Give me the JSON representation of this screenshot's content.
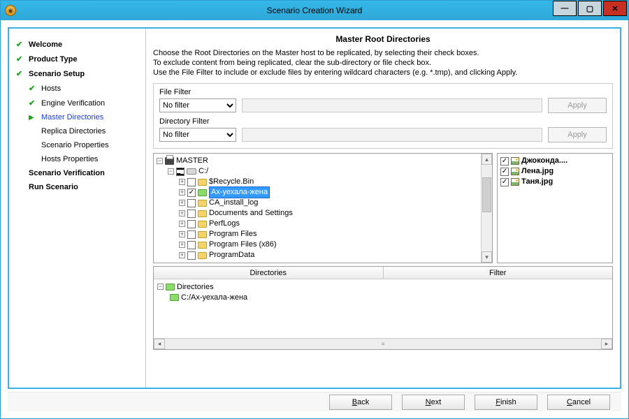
{
  "window": {
    "title": "Scenario Creation Wizard"
  },
  "nav": {
    "welcome": "Welcome",
    "product_type": "Product Type",
    "scenario_setup": "Scenario Setup",
    "hosts": "Hosts",
    "engine_verification": "Engine Verification",
    "master_directories": "Master Directories",
    "replica_directories": "Replica Directories",
    "scenario_properties": "Scenario Properties",
    "hosts_properties": "Hosts Properties",
    "scenario_verification": "Scenario Verification",
    "run_scenario": "Run Scenario"
  },
  "page": {
    "title": "Master Root Directories",
    "line1": "Choose the Root Directories on the Master host to be replicated, by selecting their check boxes.",
    "line2": "To exclude content from being replicated, clear the sub-directory or file check box.",
    "line3": "Use the File Filter to include or exclude files by entering wildcard characters (e.g. *.tmp), and clicking Apply."
  },
  "filters": {
    "file_label": "File Filter",
    "dir_label": "Directory Filter",
    "file_value": "No filter",
    "dir_value": "No filter",
    "apply": "Apply"
  },
  "tree": {
    "root": "MASTER",
    "drive": "C:/",
    "items": [
      "$Recycle.Bin",
      "Ах-уехала-жена",
      "CA_install_log",
      "Documents and Settings",
      "PerfLogs",
      "Program Files",
      "Program Files (x86)",
      "ProgramData"
    ],
    "selected_index": 1,
    "checked_index": 1
  },
  "files": [
    "Джоконда....",
    "Лена.jpg",
    "Таня.jpg"
  ],
  "dir_table": {
    "col1": "Directories",
    "col2": "Filter",
    "root": "Directories",
    "path": "C:/Ах-уехала-жена"
  },
  "buttons": {
    "back": "Back",
    "next": "Next",
    "finish": "Finish",
    "cancel": "Cancel"
  }
}
